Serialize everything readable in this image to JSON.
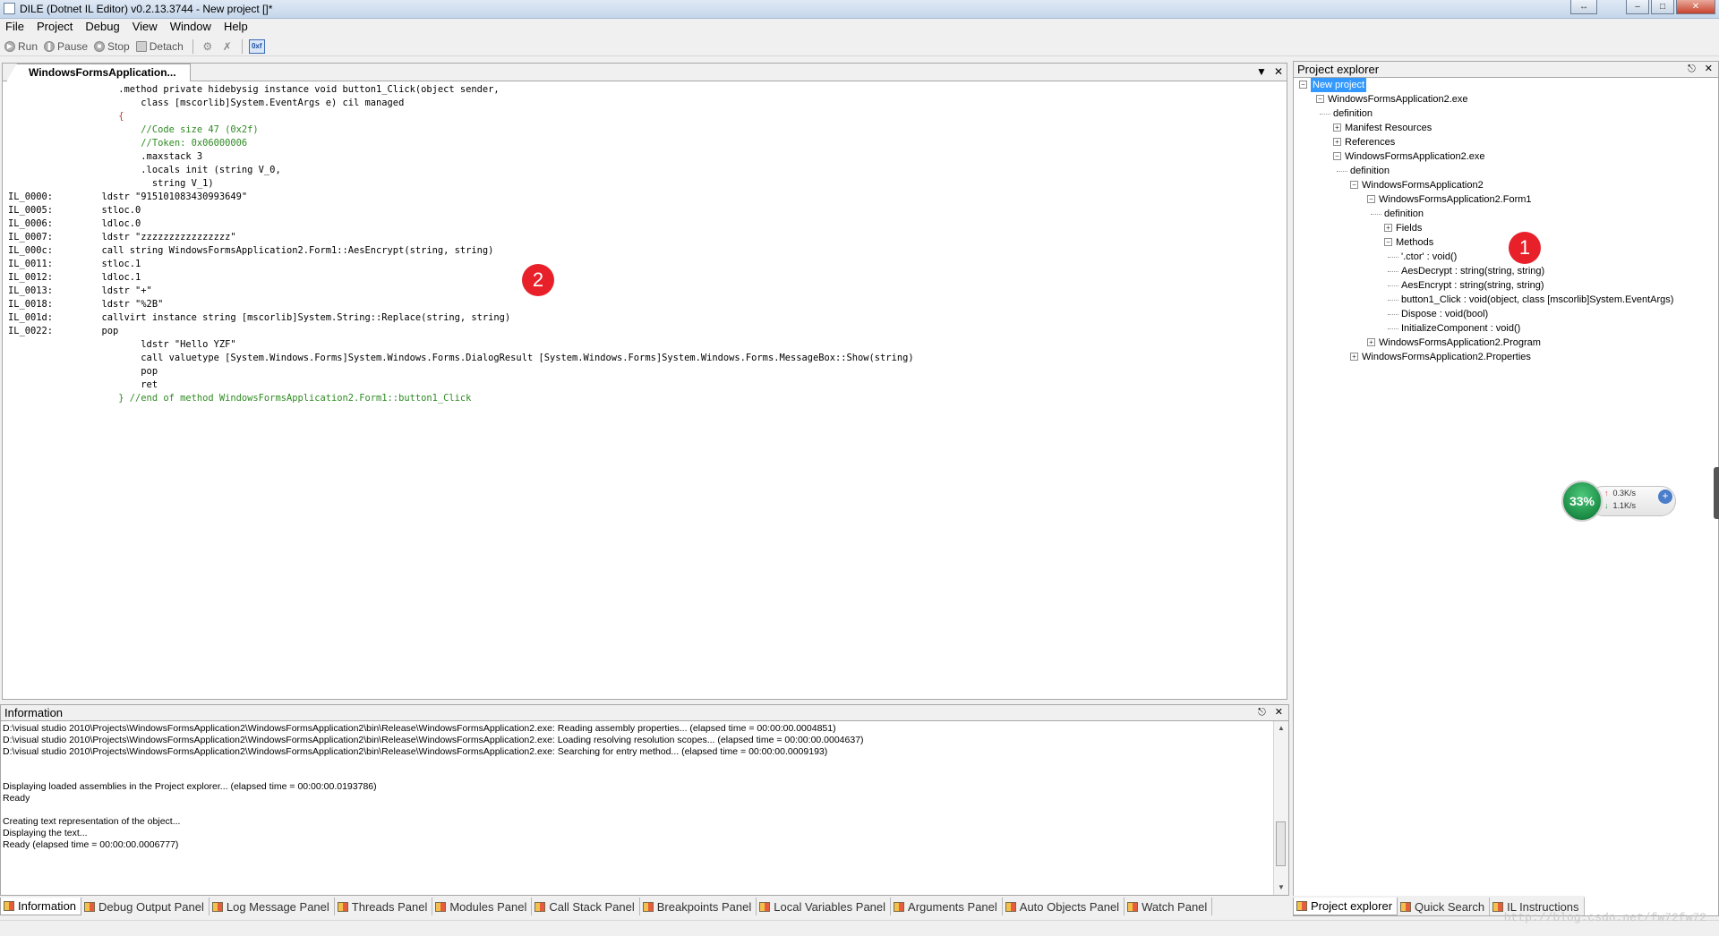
{
  "window": {
    "title": "DILE (Dotnet IL Editor) v0.2.13.3744 - New project []*",
    "buttons": [
      "↔",
      "–",
      "□",
      "✕"
    ]
  },
  "menu": [
    "File",
    "Project",
    "Debug",
    "View",
    "Window",
    "Help"
  ],
  "toolbar": {
    "run": "Run",
    "pause": "Pause",
    "stop": "Stop",
    "detach": "Detach",
    "hex_label": "0xf"
  },
  "document": {
    "tab_label": "WindowsFormsApplication...",
    "lines": [
      {
        "label": "",
        "text": "     .method private hidebysig instance void button1_Click(object sender,",
        "kind": "code"
      },
      {
        "label": "",
        "text": "         class [mscorlib]System.EventArgs e) cil managed",
        "kind": "code"
      },
      {
        "label": "",
        "text": "     {",
        "kind": "brace-red"
      },
      {
        "label": "",
        "text": "         //Code size 47 (0x2f)",
        "kind": "comment"
      },
      {
        "label": "",
        "text": "         //Token: 0x06000006",
        "kind": "comment"
      },
      {
        "label": "",
        "text": "         .maxstack 3",
        "kind": "code"
      },
      {
        "label": "",
        "text": "         .locals init (string V_0,",
        "kind": "code"
      },
      {
        "label": "",
        "text": "           string V_1)",
        "kind": "code"
      },
      {
        "label": "IL_0000:",
        "text": "  ldstr \"915101083430993649\"",
        "kind": "code"
      },
      {
        "label": "IL_0005:",
        "text": "  stloc.0",
        "kind": "code"
      },
      {
        "label": "IL_0006:",
        "text": "  ldloc.0",
        "kind": "code"
      },
      {
        "label": "IL_0007:",
        "text": "  ldstr \"zzzzzzzzzzzzzzzz\"",
        "kind": "code"
      },
      {
        "label": "IL_000c:",
        "text": "  call string WindowsFormsApplication2.Form1::AesEncrypt(string, string)",
        "kind": "code"
      },
      {
        "label": "IL_0011:",
        "text": "  stloc.1",
        "kind": "code"
      },
      {
        "label": "IL_0012:",
        "text": "  ldloc.1",
        "kind": "code"
      },
      {
        "label": "IL_0013:",
        "text": "  ldstr \"+\"",
        "kind": "code"
      },
      {
        "label": "IL_0018:",
        "text": "  ldstr \"%2B\"",
        "kind": "code"
      },
      {
        "label": "IL_001d:",
        "text": "  callvirt instance string [mscorlib]System.String::Replace(string, string)",
        "kind": "code"
      },
      {
        "label": "IL_0022:",
        "text": "  pop",
        "kind": "code"
      },
      {
        "label": "",
        "text": "         ldstr \"Hello YZF\"",
        "kind": "code"
      },
      {
        "label": "",
        "text": "         call valuetype [System.Windows.Forms]System.Windows.Forms.DialogResult [System.Windows.Forms]System.Windows.Forms.MessageBox::Show(string)",
        "kind": "code"
      },
      {
        "label": "",
        "text": "         pop",
        "kind": "code"
      },
      {
        "label": "",
        "text": "         ret",
        "kind": "code"
      },
      {
        "label": "",
        "text": "     } //end of method WindowsFormsApplication2.Form1::button1_Click",
        "kind": "endcmt"
      }
    ]
  },
  "project_explorer": {
    "title": "Project explorer",
    "nodes": [
      {
        "label": "New project",
        "depth": 0,
        "exp": "-",
        "selected": true
      },
      {
        "label": "WindowsFormsApplication2.exe",
        "depth": 1,
        "exp": "-"
      },
      {
        "label": "definition",
        "depth": 2,
        "exp": ""
      },
      {
        "label": "Manifest Resources",
        "depth": 2,
        "exp": "+"
      },
      {
        "label": "References",
        "depth": 2,
        "exp": "+"
      },
      {
        "label": "WindowsFormsApplication2.exe",
        "depth": 2,
        "exp": "-"
      },
      {
        "label": "definition",
        "depth": 3,
        "exp": ""
      },
      {
        "label": "WindowsFormsApplication2",
        "depth": 3,
        "exp": "-"
      },
      {
        "label": "WindowsFormsApplication2.Form1",
        "depth": 4,
        "exp": "-"
      },
      {
        "label": "definition",
        "depth": 5,
        "exp": ""
      },
      {
        "label": "Fields",
        "depth": 5,
        "exp": "+"
      },
      {
        "label": "Methods",
        "depth": 5,
        "exp": "-"
      },
      {
        "label": "'.ctor' : void()",
        "depth": 6,
        "exp": ""
      },
      {
        "label": "AesDecrypt : string(string, string)",
        "depth": 6,
        "exp": ""
      },
      {
        "label": "AesEncrypt : string(string, string)",
        "depth": 6,
        "exp": ""
      },
      {
        "label": "button1_Click : void(object, class [mscorlib]System.EventArgs)",
        "depth": 6,
        "exp": ""
      },
      {
        "label": "Dispose : void(bool)",
        "depth": 6,
        "exp": ""
      },
      {
        "label": "InitializeComponent : void()",
        "depth": 6,
        "exp": ""
      },
      {
        "label": "WindowsFormsApplication2.Program",
        "depth": 4,
        "exp": "+"
      },
      {
        "label": "WindowsFormsApplication2.Properties",
        "depth": 3,
        "exp": "+"
      }
    ]
  },
  "information": {
    "title": "Information",
    "lines": [
      "D:\\visual studio 2010\\Projects\\WindowsFormsApplication2\\WindowsFormsApplication2\\bin\\Release\\WindowsFormsApplication2.exe: Reading assembly properties... (elapsed time = 00:00:00.0004851)",
      "D:\\visual studio 2010\\Projects\\WindowsFormsApplication2\\WindowsFormsApplication2\\bin\\Release\\WindowsFormsApplication2.exe: Loading resolving resolution scopes... (elapsed time = 00:00:00.0004637)",
      "D:\\visual studio 2010\\Projects\\WindowsFormsApplication2\\WindowsFormsApplication2\\bin\\Release\\WindowsFormsApplication2.exe: Searching for entry method... (elapsed time = 00:00:00.0009193)",
      "",
      "",
      "Displaying loaded assemblies in the Project explorer... (elapsed time = 00:00:00.0193786)",
      "Ready",
      "",
      "Creating text representation of the object...",
      "Displaying the text...",
      "Ready (elapsed time = 00:00:00.0006777)"
    ]
  },
  "bottom_tabs_left": [
    {
      "label": "Information",
      "active": true
    },
    {
      "label": "Debug Output Panel",
      "active": false
    },
    {
      "label": "Log Message Panel",
      "active": false
    },
    {
      "label": "Threads Panel",
      "active": false
    },
    {
      "label": "Modules Panel",
      "active": false
    },
    {
      "label": "Call Stack Panel",
      "active": false
    },
    {
      "label": "Breakpoints Panel",
      "active": false
    },
    {
      "label": "Local Variables Panel",
      "active": false
    },
    {
      "label": "Arguments Panel",
      "active": false
    },
    {
      "label": "Auto Objects Panel",
      "active": false
    },
    {
      "label": "Watch Panel",
      "active": false
    }
  ],
  "bottom_tabs_right": [
    {
      "label": "Project explorer",
      "active": true
    },
    {
      "label": "Quick Search",
      "active": false
    },
    {
      "label": "IL Instructions",
      "active": false
    }
  ],
  "net_widget": {
    "percent": "33%",
    "up": "0.3K/s",
    "down": "1.1K/s"
  },
  "annotations": {
    "badge1": "1",
    "badge2": "2"
  },
  "watermark": "http://blog.csdn.net/fw72fw72",
  "colors": {
    "selection": "#3399ff",
    "comment": "#2e8b22",
    "badge": "#e8202a"
  }
}
